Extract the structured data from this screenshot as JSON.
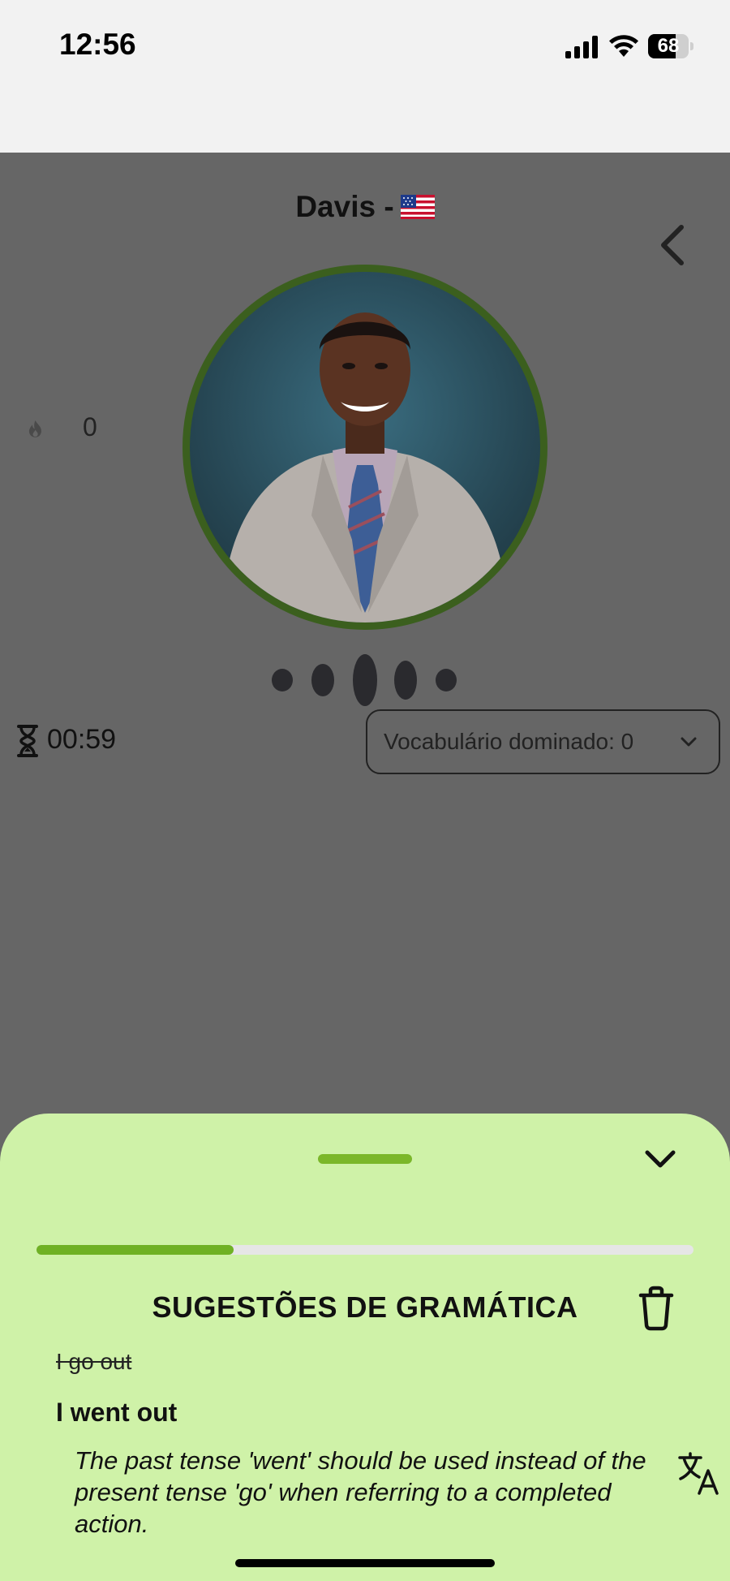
{
  "status_bar": {
    "time": "12:56",
    "battery": "68",
    "battery_level": 0.68
  },
  "header": {
    "title": "Davis -",
    "flag": "us-flag-icon",
    "back_icon": "chevron-left-icon"
  },
  "stats": {
    "streak_icon": "flame-icon",
    "streak": "0",
    "timer_icon": "hourglass-icon",
    "timer": "00:59"
  },
  "vocab_dropdown": {
    "label": "Vocabulário dominado: 0",
    "icon": "chevron-down-icon"
  },
  "grammar_sheet": {
    "title": "SUGESTÕES DE GRAMÁTICA",
    "progress": 0.3,
    "wrong_text": "I go out",
    "correct_text": "I went out",
    "explanation": "The past tense 'went' should be used instead of the present tense 'go' when referring to a completed action.",
    "icons": [
      "trash-icon",
      "translate-icon",
      "chevron-down-icon"
    ]
  },
  "colors": {
    "overlay": "#666666",
    "sheet_bg": "#cff2a8",
    "accent_green": "#6fb124",
    "ring": "#3b5f1e"
  }
}
